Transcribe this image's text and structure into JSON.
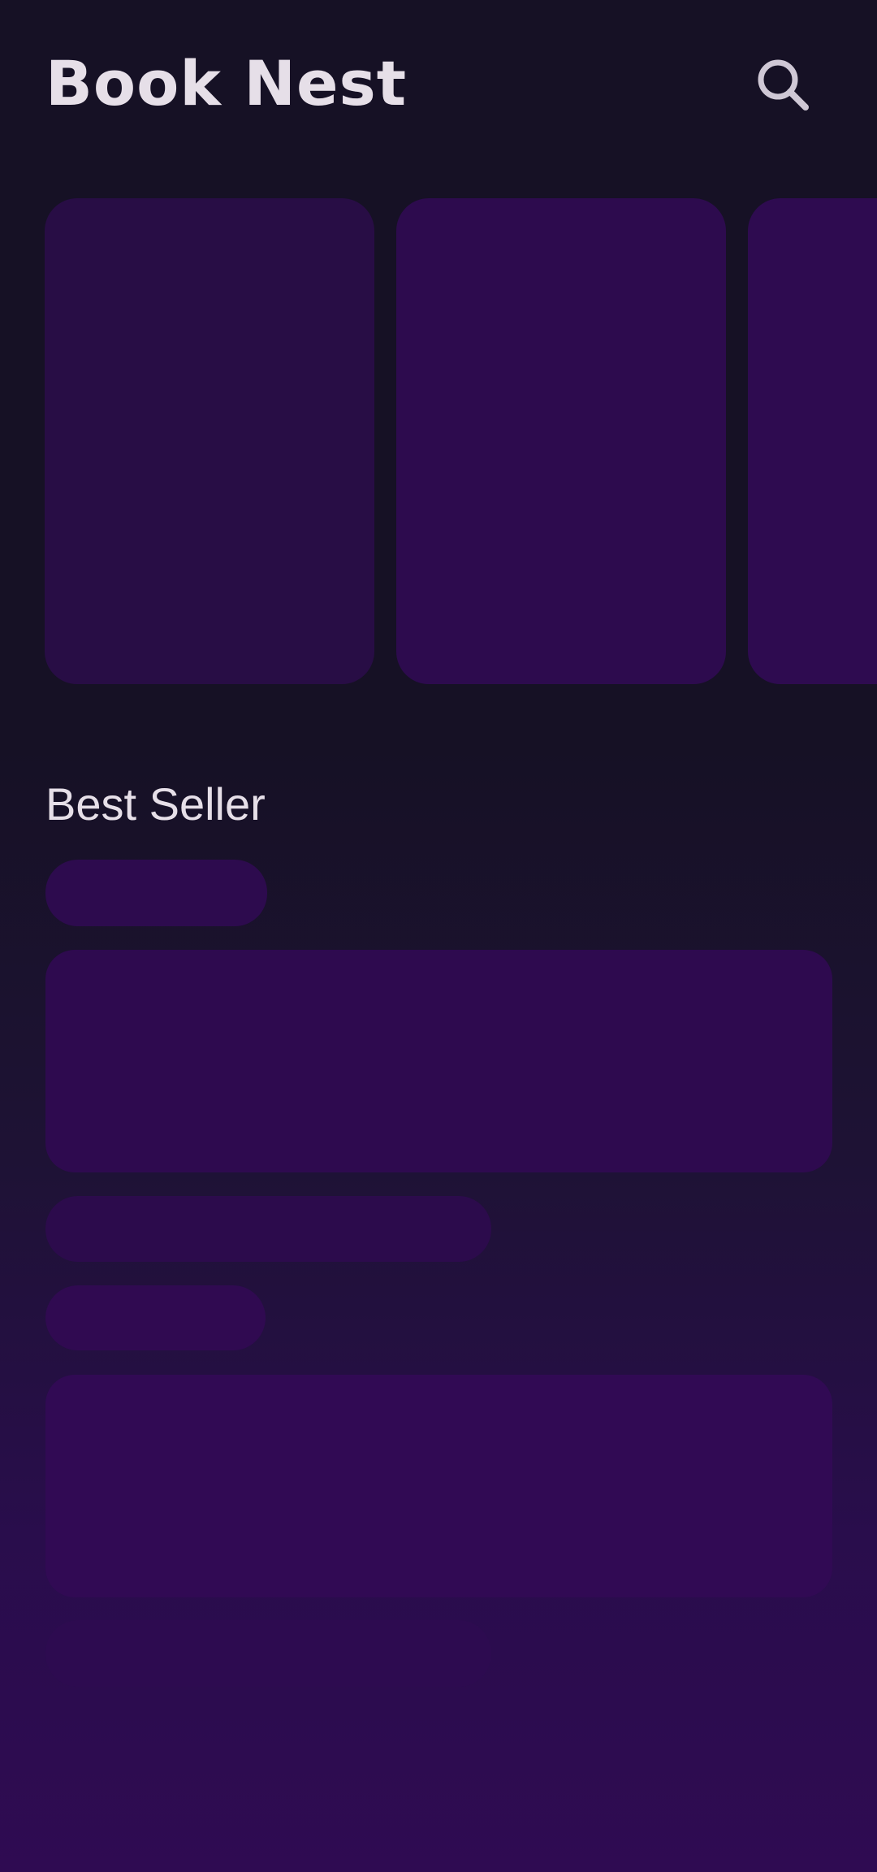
{
  "header": {
    "title": "Book Nest",
    "search_icon": "search-icon"
  },
  "carousel": {
    "card_count_visible": 3
  },
  "best_seller": {
    "title": "Best Seller"
  },
  "colors": {
    "background_top": "#161125",
    "background_bottom": "#2f0b52",
    "skeleton": "#2d0b4e",
    "text": "#e6dfe8"
  }
}
